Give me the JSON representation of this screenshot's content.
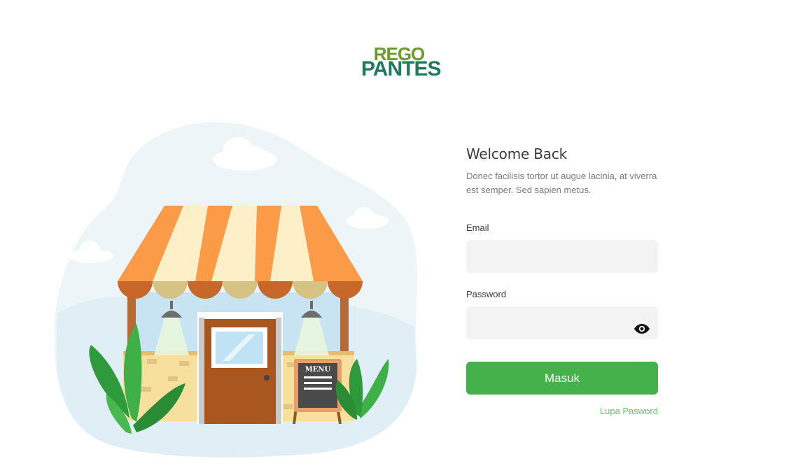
{
  "brand": {
    "line1": "REGO",
    "line2": "PANTES"
  },
  "login": {
    "title": "Welcome Back",
    "subtitle": "Donec facilisis tortor ut augue lacinia, at viverra est semper. Sed sapien metus.",
    "email_label": "Email",
    "email_value": "",
    "password_label": "Password",
    "password_value": "",
    "submit_label": "Masuk",
    "forgot_label": "Lupa Pasword"
  },
  "illustration": {
    "sign_text": "MENU"
  },
  "icons": {
    "password_toggle": "eye-icon"
  },
  "colors": {
    "accent": "#44b14a",
    "link": "#6bc26f",
    "input_bg": "#f3f3f3",
    "awning_orange": "#fb9b48",
    "awning_cream": "#fdf0c8"
  }
}
